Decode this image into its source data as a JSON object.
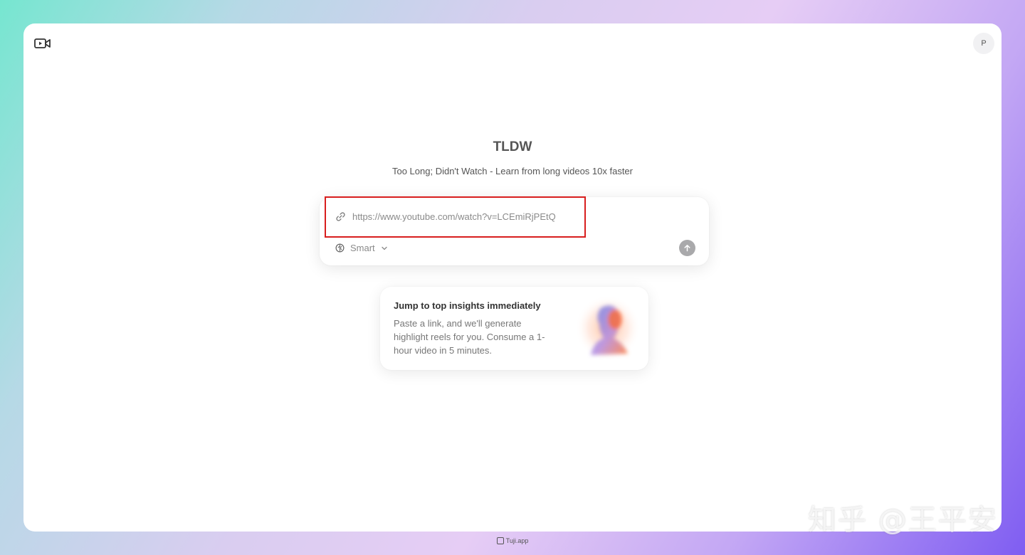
{
  "header": {
    "avatar_initial": "P",
    "camera_icon": "video-camera-icon"
  },
  "hero": {
    "title": "TLDW",
    "subtitle": "Too Long; Didn't Watch - Learn from long videos 10x faster"
  },
  "input_card": {
    "url_value": "https://www.youtube.com/watch?v=LCEmiRjPEtQ",
    "mode_label": "Smart",
    "icons": {
      "link": "link-icon",
      "mode": "brain-icon",
      "send": "arrow-up-icon"
    }
  },
  "tip_card": {
    "title": "Jump to top insights immediately",
    "body": "Paste a link, and we'll generate highlight reels for you. Consume a 1-hour video in 5 minutes."
  },
  "watermark": "知乎 @王平安",
  "footer": {
    "brand": "Tuji.app"
  },
  "colors": {
    "highlight": "#d81e1e",
    "send_button": "#a9a9ab"
  }
}
